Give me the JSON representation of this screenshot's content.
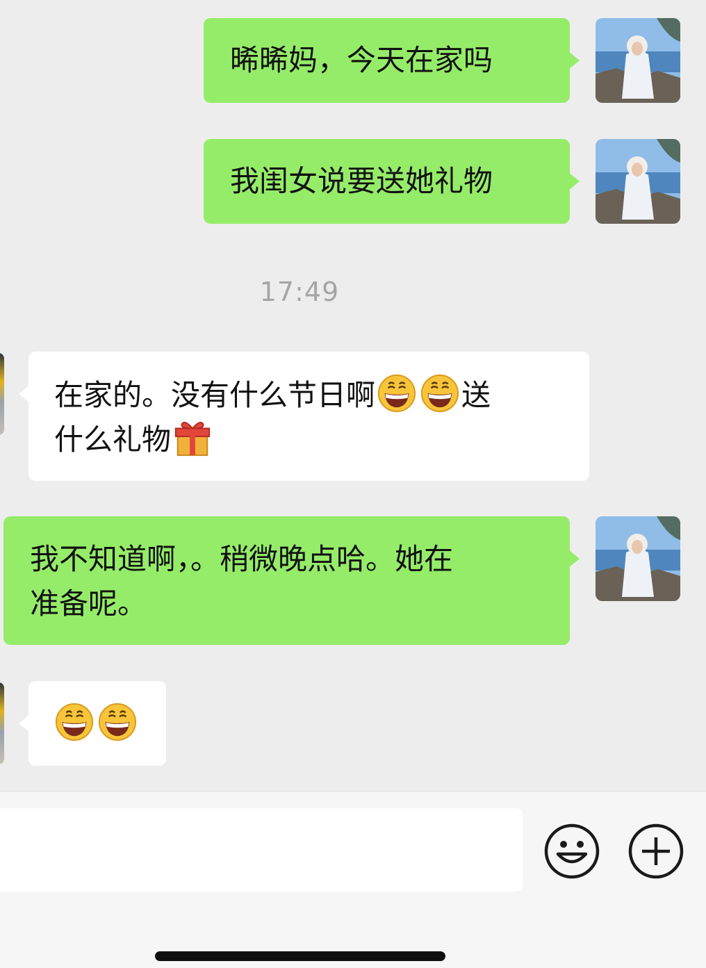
{
  "chat": {
    "messages": [
      {
        "side": "me",
        "text": "晞晞妈，今天在家吗"
      },
      {
        "side": "me",
        "text": "我闺女说要送她礼物"
      },
      {
        "side": "them",
        "parts": [
          "在家的。没有什么节日啊",
          "送",
          "什么礼物"
        ],
        "emojis": [
          "grinning-face",
          "grinning-face",
          "wrapped-gift"
        ]
      },
      {
        "side": "me",
        "lines": [
          "我不知道啊，。稍微晚点哈。她在",
          "准备呢。"
        ]
      },
      {
        "side": "them",
        "emojis": [
          "grinning-face",
          "grinning-face"
        ]
      }
    ],
    "timestamp": "17:49"
  },
  "bottom_bar": {
    "input_value": "",
    "emoji_button_icon": "smiley-face-icon",
    "more_button_icon": "plus-circle-icon"
  },
  "colors": {
    "background": "#ededed",
    "my_bubble": "#95ec69",
    "their_bubble": "#ffffff",
    "timestamp": "#a5a5a5"
  }
}
